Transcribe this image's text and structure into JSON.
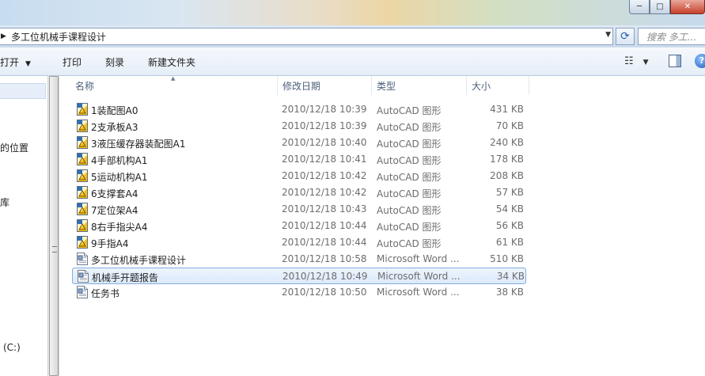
{
  "window": {
    "min_label": "─",
    "max_label": "□",
    "close_label": "✕"
  },
  "address": {
    "arrow": "▶",
    "path": "多工位机械手课程设计",
    "dropdown": "▼",
    "refresh": "⟳"
  },
  "search": {
    "placeholder": "搜索 多工..."
  },
  "toolbar": {
    "open_label": "打开",
    "open_caret": "▼",
    "print_label": "打印",
    "burn_label": "刻录",
    "new_folder_label": "新建文件夹",
    "view_icon": "☷",
    "view_caret": "▼",
    "help_label": "?"
  },
  "nav": {
    "items": [
      {
        "label": "的位置"
      },
      {
        "label": "库"
      },
      {
        "label": "(C:)"
      }
    ]
  },
  "columns": {
    "sort_arrow": "▲",
    "name": "名称",
    "date": "修改日期",
    "type": "类型",
    "size": "大小"
  },
  "files": [
    {
      "name": "1装配图A0",
      "date": "2010/12/18 10:39",
      "type": "AutoCAD 图形",
      "size": "431 KB",
      "icon": "autocad-icon"
    },
    {
      "name": "2支承板A3",
      "date": "2010/12/18 10:39",
      "type": "AutoCAD 图形",
      "size": "70 KB",
      "icon": "autocad-icon"
    },
    {
      "name": "3液压缓存器装配图A1",
      "date": "2010/12/18 10:40",
      "type": "AutoCAD 图形",
      "size": "240 KB",
      "icon": "autocad-icon"
    },
    {
      "name": "4手部机构A1",
      "date": "2010/12/18 10:41",
      "type": "AutoCAD 图形",
      "size": "178 KB",
      "icon": "autocad-icon"
    },
    {
      "name": "5运动机构A1",
      "date": "2010/12/18 10:42",
      "type": "AutoCAD 图形",
      "size": "208 KB",
      "icon": "autocad-icon"
    },
    {
      "name": "6支撑套A4",
      "date": "2010/12/18 10:42",
      "type": "AutoCAD 图形",
      "size": "57 KB",
      "icon": "autocad-icon"
    },
    {
      "name": "7定位架A4",
      "date": "2010/12/18 10:43",
      "type": "AutoCAD 图形",
      "size": "54 KB",
      "icon": "autocad-icon"
    },
    {
      "name": "8右手指尖A4",
      "date": "2010/12/18 10:44",
      "type": "AutoCAD 图形",
      "size": "56 KB",
      "icon": "autocad-icon"
    },
    {
      "name": "9手指A4",
      "date": "2010/12/18 10:44",
      "type": "AutoCAD 图形",
      "size": "61 KB",
      "icon": "autocad-icon"
    },
    {
      "name": "多工位机械手课程设计",
      "date": "2010/12/18 10:58",
      "type": "Microsoft Word ...",
      "size": "510 KB",
      "icon": "word-doc-icon"
    },
    {
      "name": "机械手开题报告",
      "date": "2010/12/18 10:49",
      "type": "Microsoft Word ...",
      "size": "34 KB",
      "icon": "word-doc-icon",
      "selected": true
    },
    {
      "name": "任务书",
      "date": "2010/12/18 10:50",
      "type": "Microsoft Word ...",
      "size": "38 KB",
      "icon": "word-doc-icon"
    }
  ],
  "colors": {
    "selection_border": "#84acdd",
    "selection_fill": "#dceafc",
    "header_text": "#4c607a"
  }
}
